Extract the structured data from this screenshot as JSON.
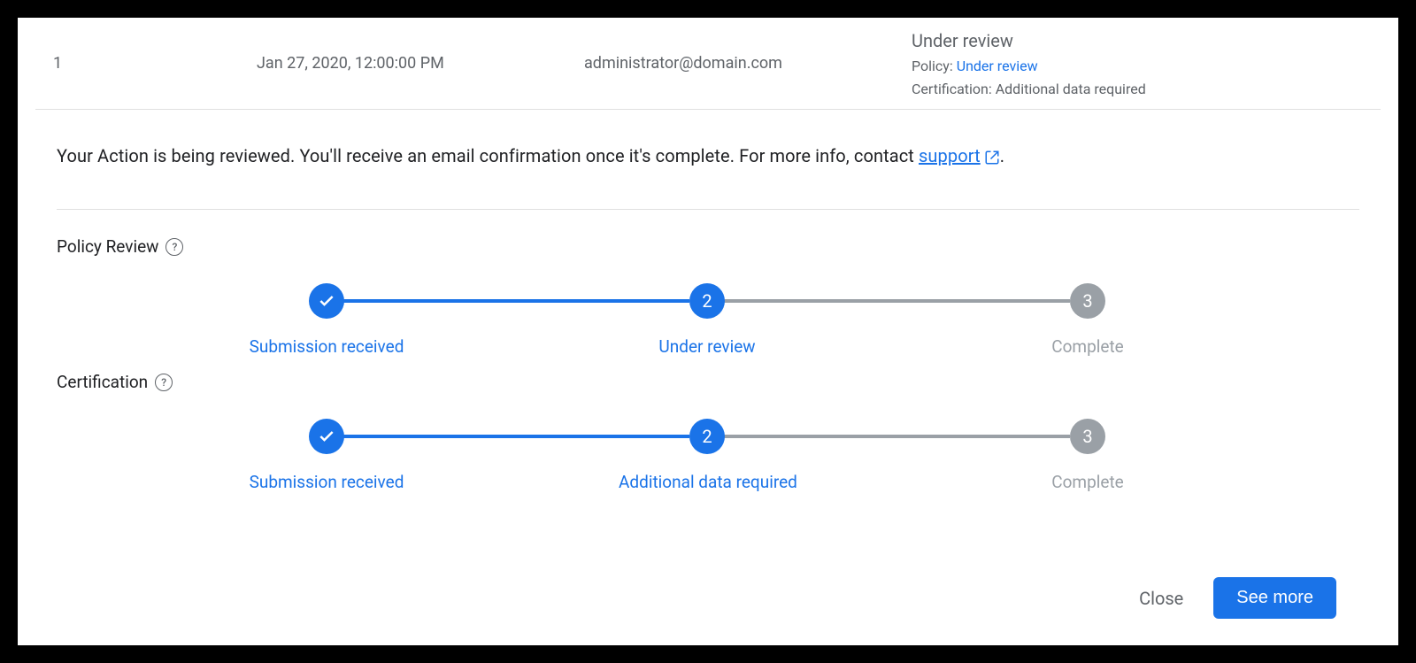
{
  "row": {
    "number": "1",
    "date": "Jan 27, 2020, 12:00:00 PM",
    "email": "administrator@domain.com",
    "status_title": "Under review",
    "policy_label": "Policy:",
    "policy_value": "Under review",
    "cert_label": "Certification:",
    "cert_value": "Additional data required"
  },
  "message": {
    "text_before": "Your Action is being reviewed. You'll receive an email confirmation once it's complete. For more info, contact ",
    "link": "support",
    "text_after": "."
  },
  "policy_review": {
    "title": "Policy Review",
    "steps": [
      "Submission received",
      "Under review",
      "Complete"
    ]
  },
  "certification": {
    "title": "Certification",
    "steps": [
      "Submission received",
      "Additional data required",
      "Complete"
    ]
  },
  "footer": {
    "close": "Close",
    "see_more": "See more"
  },
  "step_numbers": {
    "two": "2",
    "three": "3"
  }
}
